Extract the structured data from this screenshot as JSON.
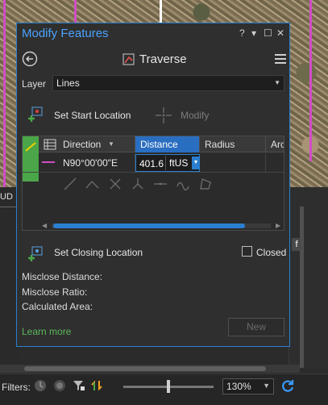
{
  "dialog": {
    "title": "Modify Features",
    "help": "?",
    "menu_arrow": "▾",
    "maximize": "☐",
    "close": "✕"
  },
  "tool": {
    "name": "Traverse"
  },
  "layer": {
    "label": "Layer",
    "value": "Lines"
  },
  "actions": {
    "set_start_location": "Set Start Location",
    "modify": "Modify",
    "set_closing_location": "Set Closing Location",
    "closed_label": "Closed",
    "closed_checked": false
  },
  "grid": {
    "columns": {
      "direction": "Direction",
      "distance": "Distance",
      "radius": "Radius",
      "arc": "Arc"
    },
    "row": {
      "direction": "N90°00'00\"E",
      "distance": "401.6",
      "unit": "ftUS"
    }
  },
  "stats": {
    "misclose_distance": "Misclose Distance:",
    "misclose_ratio": "Misclose Ratio:",
    "calculated_area": "Calculated Area:"
  },
  "footer": {
    "learn_more": "Learn more",
    "new_button": "New"
  },
  "app": {
    "left_tab": "UD",
    "right_tab": "f",
    "filters_label": "Filters:",
    "zoom": "130%"
  },
  "colors": {
    "accent_blue": "#2a7fd0",
    "title_blue": "#4aa3ff",
    "link_green": "#5cb85c",
    "row_green": "#4aa648",
    "line_magenta": "#d04dc6"
  }
}
